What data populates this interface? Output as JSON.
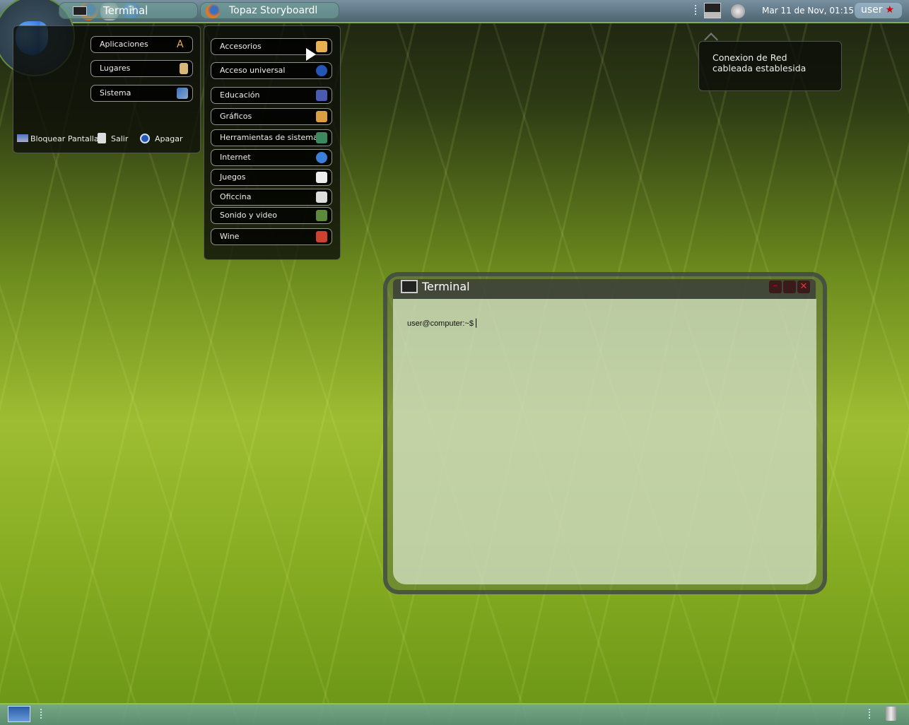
{
  "top_panel": {
    "launchers": [
      {
        "icon": "firefox-icon"
      },
      {
        "icon": "mail-icon"
      },
      {
        "icon": "help-icon"
      }
    ],
    "clock": "Mar 11 de Nov, 01:15",
    "user": "user"
  },
  "main_menu": {
    "items": [
      {
        "label": "Aplicaciones",
        "icon": "applications-icon"
      },
      {
        "label": "Lugares",
        "icon": "places-icon"
      },
      {
        "label": "Sistema",
        "icon": "system-icon"
      }
    ],
    "actions": [
      {
        "label": "Bloquear Pantalla"
      },
      {
        "label": "Salir"
      },
      {
        "label": "Apagar"
      }
    ]
  },
  "submenu": {
    "items": [
      {
        "label": "Accesorios"
      },
      {
        "label": "Acceso universal"
      },
      {
        "label": "Educación"
      },
      {
        "label": "Gráficos"
      },
      {
        "label": "Herramientas de sistema"
      },
      {
        "label": "Internet"
      },
      {
        "label": "Juegos"
      },
      {
        "label": "Oficcina"
      },
      {
        "label": "Sonido y video"
      },
      {
        "label": "Wine"
      }
    ]
  },
  "notification": {
    "text": "Conexion de Red cableada establesida"
  },
  "terminal": {
    "title": "Terminal",
    "prompt": "user@computer:~$ ▏"
  },
  "taskbar": {
    "tasks": [
      {
        "label": "Terminal"
      },
      {
        "label": "Topaz Storyboardl"
      }
    ]
  }
}
